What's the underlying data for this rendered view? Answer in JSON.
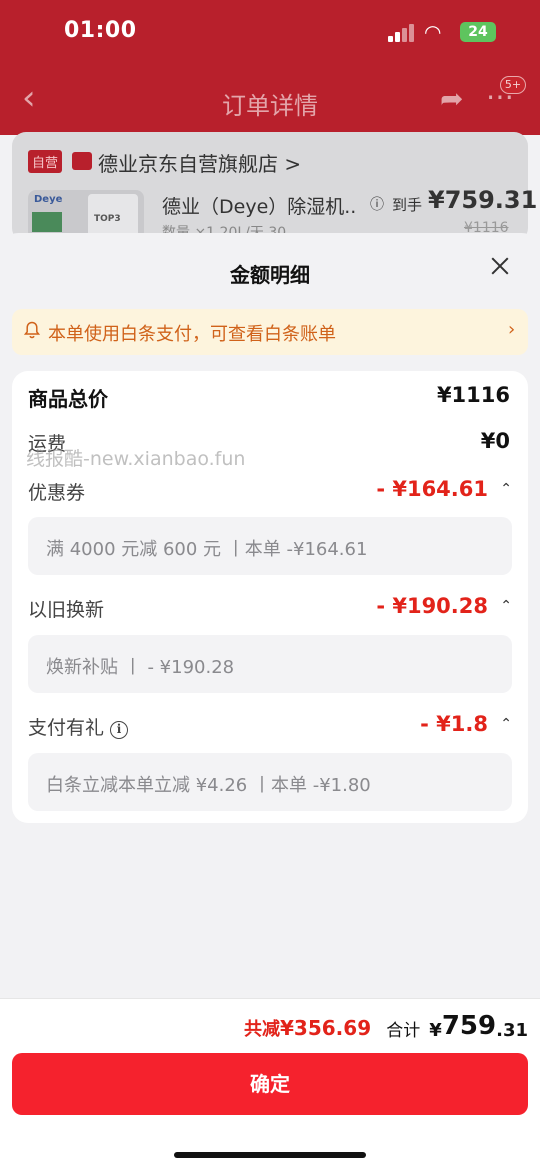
{
  "status_bar": {
    "time": "01:00",
    "battery": "24"
  },
  "nav": {
    "title": "订单详情",
    "badge": "5+"
  },
  "shop": {
    "self_tag": "自营",
    "name": "德业京东自营旗舰店 >"
  },
  "product": {
    "name": "德业（Deye）除湿机..",
    "sub": "数量 ×1  20L/天 30...",
    "price_label": "到手",
    "price": "¥759.31",
    "original_price": "¥1116",
    "thumb_brand": "Deye",
    "thumb_badge": "TOP3"
  },
  "sheet": {
    "title": "金额明细",
    "notice": "本单使用白条支付，可查看白条账单",
    "rows": {
      "goods_total": {
        "label": "商品总价",
        "value": "¥1116"
      },
      "shipping": {
        "label": "运费",
        "value": "¥0"
      },
      "coupon": {
        "label": "优惠券",
        "value": "- ¥164.61",
        "detail": "满 4000 元减 600 元  丨本单 -¥164.61"
      },
      "trade_in": {
        "label": "以旧换新",
        "value": "- ¥190.28",
        "detail": "焕新补贴  丨 - ¥190.28"
      },
      "pay_gift": {
        "label": "支付有礼",
        "value": "- ¥1.8",
        "detail": "白条立减本单立减 ¥4.26  丨本单 -¥1.80"
      }
    },
    "watermark": "线报酷-new.xianbao.fun"
  },
  "footer": {
    "reduce_label": "共减",
    "reduce_value": "¥356.69",
    "total_label": "合计",
    "total_yen": "¥",
    "total_int": "759",
    "total_dec": ".31",
    "confirm_label": "确定"
  },
  "colors": {
    "accent_red": "#e2231a",
    "button_red": "#f5222d",
    "notice_orange": "#d0621a",
    "notice_bg": "#fdf4dd",
    "header_red": "#b8202c"
  },
  "icons": [
    "back-icon",
    "share-icon",
    "more-icon",
    "close-icon",
    "bell-icon",
    "chevron-right-icon",
    "chevron-up-icon",
    "info-icon"
  ]
}
